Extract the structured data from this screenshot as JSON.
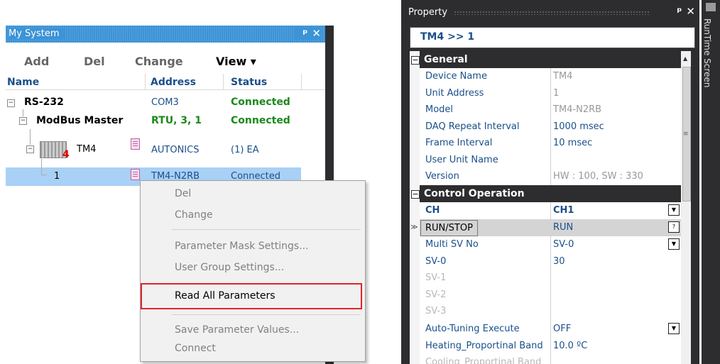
{
  "my_system": {
    "title": "My System",
    "toolbar": {
      "add": "Add",
      "del": "Del",
      "change": "Change",
      "view": "View ▾"
    },
    "columns": {
      "name": "Name",
      "address": "Address",
      "status": "Status"
    },
    "rows": [
      {
        "name": "RS-232",
        "address": "COM3",
        "status": "Connected"
      },
      {
        "name": "ModBus Master",
        "address": "RTU, 3, 1",
        "status": "Connected"
      },
      {
        "name": "TM4",
        "address": "AUTONICS",
        "status": "(1) EA",
        "badge": "4"
      },
      {
        "name": "1",
        "address": "TM4-N2RB",
        "status": "Connected"
      }
    ]
  },
  "context_menu": {
    "items": [
      {
        "label": "Del",
        "enabled": false
      },
      {
        "label": "Change",
        "enabled": false
      },
      {
        "label": "Parameter Mask Settings...",
        "enabled": false
      },
      {
        "label": "User Group Settings...",
        "enabled": false
      },
      {
        "label": "Read All Parameters",
        "enabled": true,
        "highlighted": true
      },
      {
        "label": "Save Parameter Values...",
        "enabled": false
      },
      {
        "label": "Connect",
        "enabled": false
      }
    ]
  },
  "property": {
    "title": "Property",
    "header": "TM4 >> 1",
    "general": {
      "label": "General",
      "rows": [
        {
          "name": "Device Name",
          "value": "TM4"
        },
        {
          "name": "Unit Address",
          "value": "1"
        },
        {
          "name": "Model",
          "value": "TM4-N2RB"
        },
        {
          "name": "DAQ Repeat Interval",
          "value": "1000 msec"
        },
        {
          "name": "Frame Interval",
          "value": "10 msec"
        },
        {
          "name": "User Unit Name",
          "value": ""
        },
        {
          "name": "Version",
          "value": "HW : 100, SW : 330"
        }
      ]
    },
    "control": {
      "label": "Control Operation",
      "rows": [
        {
          "name": "CH",
          "value": "CH1"
        },
        {
          "name": "RUN/STOP",
          "value": "RUN"
        },
        {
          "name": "Multi SV No",
          "value": "SV-0"
        },
        {
          "name": "SV-0",
          "value": "30"
        },
        {
          "name": "SV-1",
          "value": ""
        },
        {
          "name": "SV-2",
          "value": ""
        },
        {
          "name": "SV-3",
          "value": ""
        },
        {
          "name": "Auto-Tuning Execute",
          "value": "OFF"
        },
        {
          "name": "Heating_Proportinal Band",
          "value": "10.0 ºC"
        },
        {
          "name": "Cooling_Proportinal Band",
          "value": ""
        }
      ]
    }
  },
  "runtime_screen": {
    "label": "RunTime Screen"
  },
  "colors": {
    "title_blue": "#3c93d6",
    "selection": "#a9d0f5",
    "highlight_border": "#e2232a",
    "dark": "#2d2d30"
  }
}
